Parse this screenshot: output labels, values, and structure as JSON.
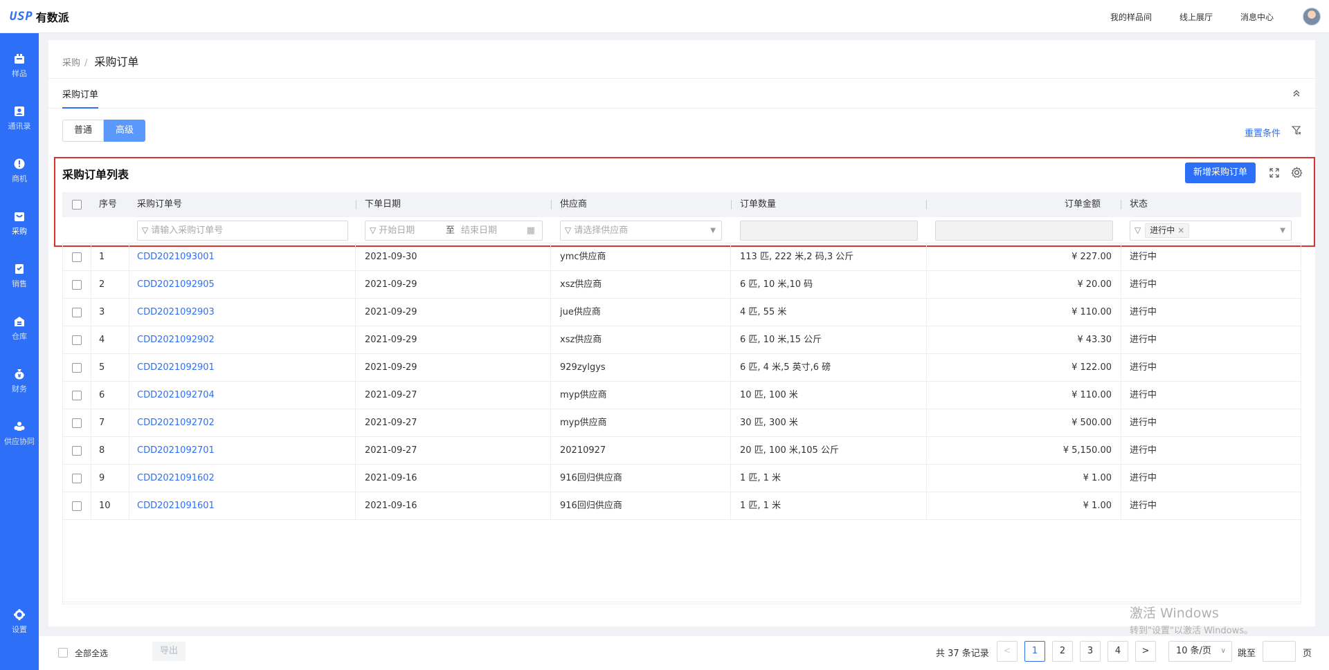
{
  "app": {
    "logo_mark": "USP",
    "logo_text": "有数派"
  },
  "topnav": [
    "我的样品间",
    "线上展厅",
    "消息中心"
  ],
  "sidebar": [
    {
      "label": "样品",
      "icon": "sample-icon"
    },
    {
      "label": "通讯录",
      "icon": "contacts-icon"
    },
    {
      "label": "商机",
      "icon": "opportunity-icon"
    },
    {
      "label": "采购",
      "icon": "purchase-icon",
      "active": true
    },
    {
      "label": "销售",
      "icon": "sales-icon"
    },
    {
      "label": "仓库",
      "icon": "warehouse-icon"
    },
    {
      "label": "财务",
      "icon": "finance-icon"
    },
    {
      "label": "供应协同",
      "icon": "supply-icon"
    },
    {
      "label": "设置",
      "icon": "settings-icon"
    }
  ],
  "breadcrumb": {
    "parent": "采购",
    "sep": "/",
    "current": "采购订单"
  },
  "tab": "采购订单",
  "mode": {
    "normal": "普通",
    "advanced": "高级"
  },
  "reset_label": "重置条件",
  "list": {
    "title": "采购订单列表",
    "new_button": "新增采购订单"
  },
  "columns": {
    "index": "序号",
    "order_no": "采购订单号",
    "date": "下单日期",
    "supplier": "供应商",
    "qty": "订单数量",
    "amount": "订单金额",
    "status": "状态"
  },
  "filters": {
    "order_placeholder": "请输入采购订单号",
    "start_date": "开始日期",
    "to": "至",
    "end_date": "结束日期",
    "supplier_placeholder": "请选择供应商",
    "status_tag": "进行中"
  },
  "rows": [
    {
      "idx": "1",
      "no": "CDD2021093001",
      "date": "2021-09-30",
      "supplier": "ymc供应商",
      "qty": "113 匹, 222 米,2 码,3 公斤",
      "amount": "¥ 227.00",
      "status": "进行中"
    },
    {
      "idx": "2",
      "no": "CDD2021092905",
      "date": "2021-09-29",
      "supplier": "xsz供应商",
      "qty": "6 匹, 10 米,10 码",
      "amount": "¥ 20.00",
      "status": "进行中"
    },
    {
      "idx": "3",
      "no": "CDD2021092903",
      "date": "2021-09-29",
      "supplier": "jue供应商",
      "qty": "4 匹, 55 米",
      "amount": "¥ 110.00",
      "status": "进行中"
    },
    {
      "idx": "4",
      "no": "CDD2021092902",
      "date": "2021-09-29",
      "supplier": "xsz供应商",
      "qty": "6 匹, 10 米,15 公斤",
      "amount": "¥ 43.30",
      "status": "进行中"
    },
    {
      "idx": "5",
      "no": "CDD2021092901",
      "date": "2021-09-29",
      "supplier": "929zylgys",
      "qty": "6 匹, 4 米,5 英寸,6 磅",
      "amount": "¥ 122.00",
      "status": "进行中"
    },
    {
      "idx": "6",
      "no": "CDD2021092704",
      "date": "2021-09-27",
      "supplier": "myp供应商",
      "qty": "10 匹, 100 米",
      "amount": "¥ 110.00",
      "status": "进行中"
    },
    {
      "idx": "7",
      "no": "CDD2021092702",
      "date": "2021-09-27",
      "supplier": "myp供应商",
      "qty": "30 匹, 300 米",
      "amount": "¥ 500.00",
      "status": "进行中"
    },
    {
      "idx": "8",
      "no": "CDD2021092701",
      "date": "2021-09-27",
      "supplier": "20210927",
      "qty": "20 匹, 100 米,105 公斤",
      "amount": "¥ 5,150.00",
      "status": "进行中"
    },
    {
      "idx": "9",
      "no": "CDD2021091602",
      "date": "2021-09-16",
      "supplier": "916回归供应商",
      "qty": "1 匹, 1 米",
      "amount": "¥ 1.00",
      "status": "进行中"
    },
    {
      "idx": "10",
      "no": "CDD2021091601",
      "date": "2021-09-16",
      "supplier": "916回归供应商",
      "qty": "1 匹, 1 米",
      "amount": "¥ 1.00",
      "status": "进行中"
    }
  ],
  "footer": {
    "select_all": "全部全选",
    "export": "导出",
    "total": "共 37 条记录",
    "pages": [
      "1",
      "2",
      "3",
      "4"
    ],
    "prev": "<",
    "next": ">",
    "page_size": "10 条/页",
    "jump": "跳至",
    "page_unit": "页"
  },
  "watermark": {
    "line1": "激活 Windows",
    "line2": "转到\"设置\"以激活 Windows。"
  },
  "colors": {
    "primary": "#2d6ff7",
    "highlight_box": "#d9312b"
  }
}
